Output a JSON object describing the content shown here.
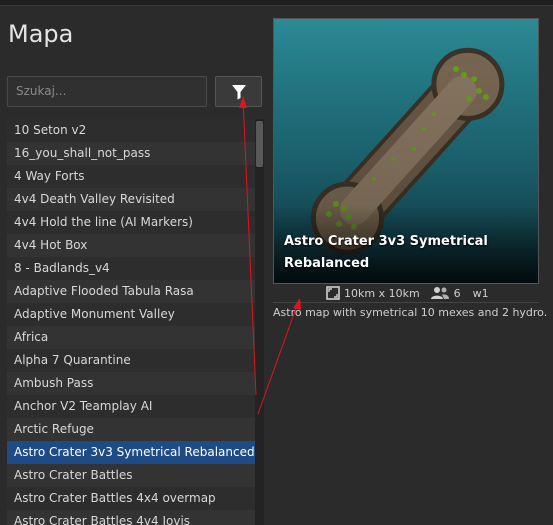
{
  "page": {
    "title": "Mapa"
  },
  "search": {
    "placeholder": "Szukaj..."
  },
  "map_list": {
    "items": [
      "10 Seton v2",
      "16_you_shall_not_pass",
      "4 Way Forts",
      "4v4 Death Valley Revisited",
      "4v4 Hold the line (AI Markers)",
      "4v4 Hot Box",
      "8 - Badlands_v4",
      "Adaptive Flooded Tabula Rasa",
      "Adaptive Monument Valley",
      "Africa",
      "Alpha 7 Quarantine",
      "Ambush Pass",
      "Anchor V2 Teamplay AI",
      "Arctic Refuge",
      "Astro Crater 3v3 Symetrical Rebalanced",
      "Astro Crater Battles",
      "Astro Crater Battles 4x4 overmap",
      "Astro Crater Battles 4v4 Jovis"
    ],
    "selected_index": 14
  },
  "preview": {
    "map_name": "Astro Crater 3v3 Symetrical Rebalanced",
    "size": "10km x 10km",
    "players": "6",
    "version": "w1",
    "description": "Astro map with symetrical 10 mexes and 2 hydro."
  },
  "icons": {
    "filter": "filter-funnel-icon",
    "size": "expand-square-icon",
    "players": "players-group-icon"
  },
  "colors": {
    "selection": "#1e4b86",
    "annotation_arrow": "#e0141e"
  }
}
